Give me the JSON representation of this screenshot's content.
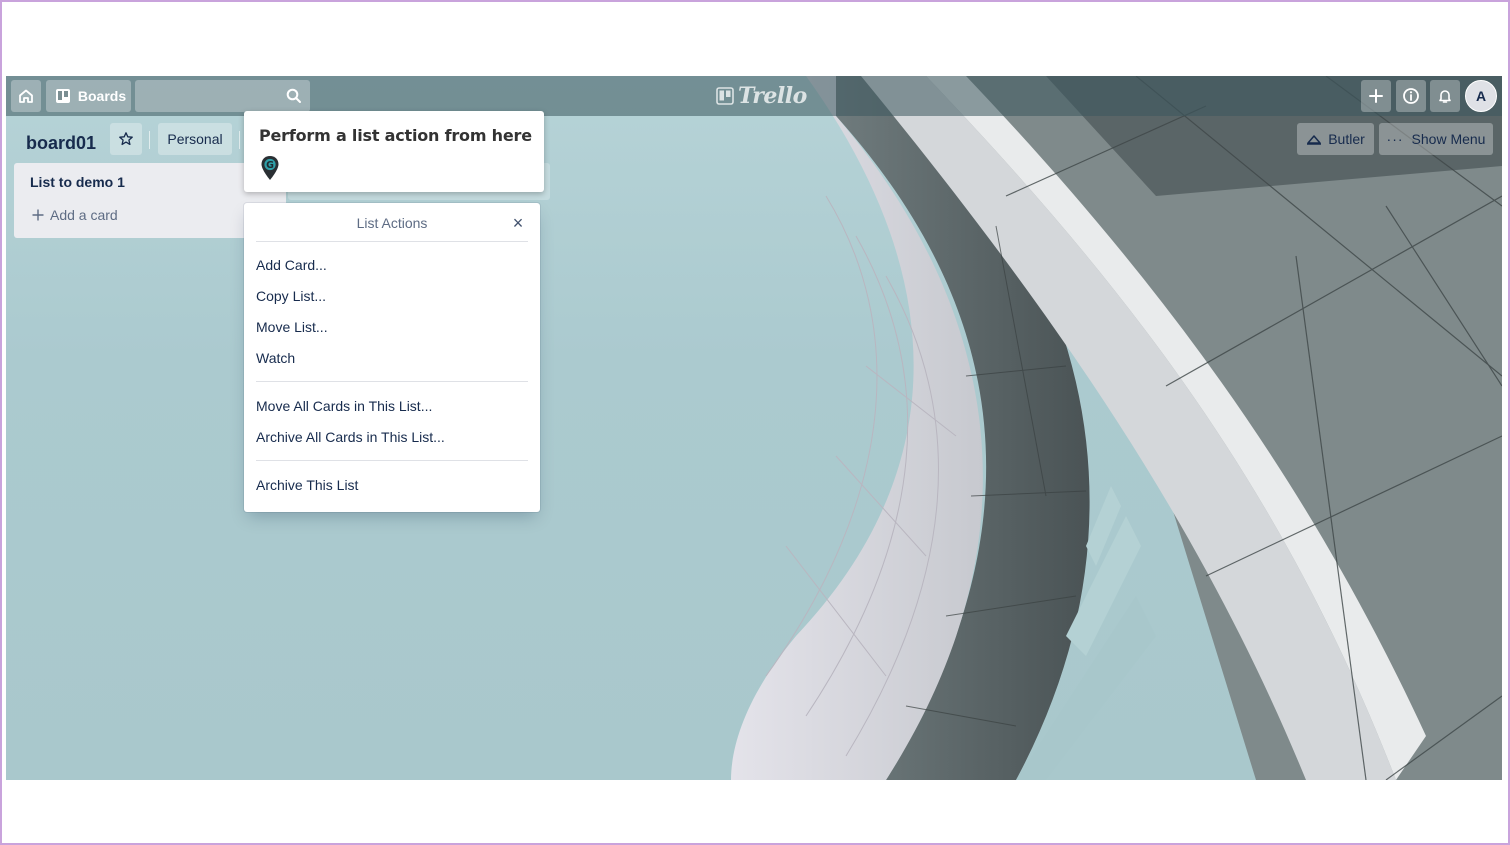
{
  "header": {
    "boards_label": "Boards",
    "logo_text": "Trello",
    "avatar_initial": "A"
  },
  "board": {
    "title": "board01",
    "visibility_label": "Personal",
    "butler_label": "Butler",
    "show_menu_label": "Show Menu"
  },
  "list": {
    "title": "List to demo 1",
    "add_card_label": "Add a card"
  },
  "tour": {
    "text": "Perform a list action from here",
    "pin_letter": "G"
  },
  "popover": {
    "title": "List Actions",
    "close_label": "×",
    "group1": [
      "Add Card...",
      "Copy List...",
      "Move List...",
      "Watch"
    ],
    "group2": [
      "Move All Cards in This List...",
      "Archive All Cards in This List..."
    ],
    "group3": [
      "Archive This List"
    ]
  },
  "colors": {
    "accent_purple_border": "#c9a3dc",
    "board_bg": "#abcacf",
    "text_primary": "#172b4d",
    "text_muted": "#5e6c84"
  }
}
